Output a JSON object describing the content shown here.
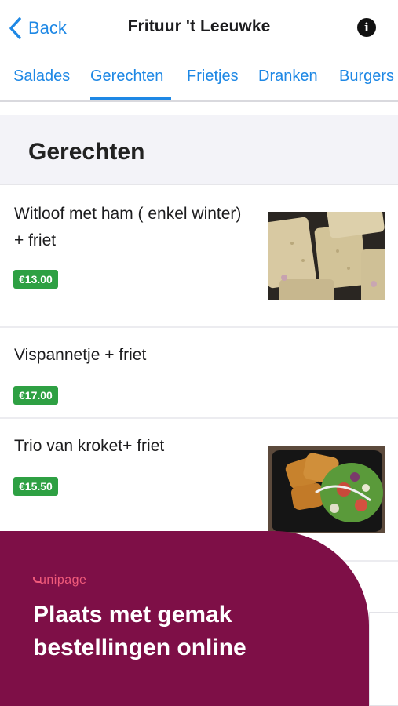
{
  "header": {
    "back_label": "Back",
    "title": "Frituur 't Leeuwke",
    "info_glyph": "i"
  },
  "tabs": [
    {
      "label": "Salades",
      "active": false
    },
    {
      "label": "Gerechten",
      "active": true
    },
    {
      "label": "Frietjes",
      "active": false
    },
    {
      "label": "Dranken",
      "active": false
    },
    {
      "label": "Burgers",
      "active": false
    }
  ],
  "section": {
    "title": "Gerechten"
  },
  "items": [
    {
      "name": "Witloof met ham ( enkel winter) + friet",
      "price": "€13.00",
      "has_image": true
    },
    {
      "name": "Vispannetje + friet",
      "price": "€17.00",
      "has_image": false
    },
    {
      "name": "Trio van kroket+ friet",
      "price": "€15.50",
      "has_image": true
    }
  ],
  "banner": {
    "brand": "unipage",
    "headline": "Plaats met gemak bestellingen online"
  },
  "colors": {
    "accent": "#1e88e5",
    "price_badge": "#2ea043",
    "banner_bg": "#7e0f47",
    "brand": "#f05a7a"
  }
}
